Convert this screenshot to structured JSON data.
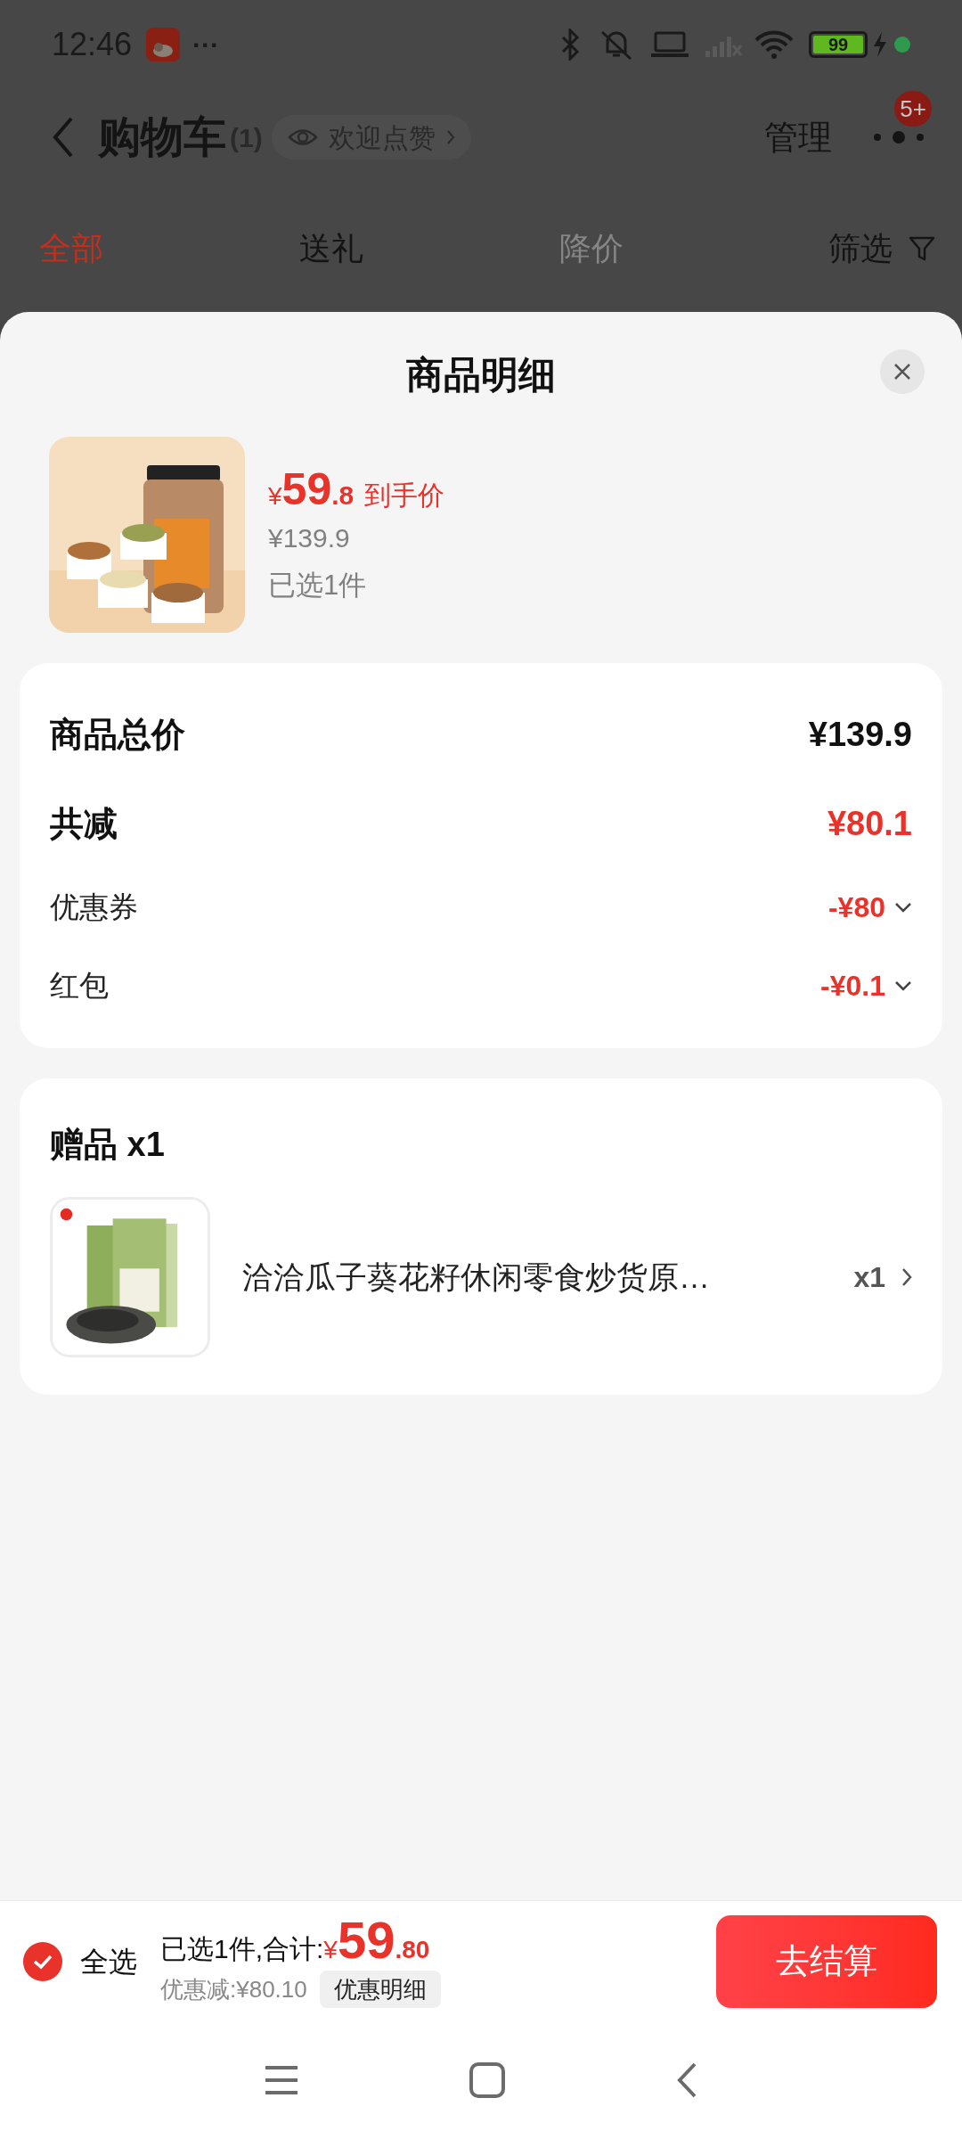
{
  "status_bar": {
    "time": "12:46",
    "more": "···",
    "battery": "99"
  },
  "header": {
    "title": "购物车",
    "count": "(1)",
    "like_chip": "欢迎点赞",
    "manage": "管理",
    "badge": "5+"
  },
  "tabs": [
    {
      "label": "全部",
      "selected": true,
      "disabled": false
    },
    {
      "label": "送礼",
      "selected": false,
      "disabled": false
    },
    {
      "label": "降价",
      "selected": false,
      "disabled": true
    }
  ],
  "filter": "筛选",
  "sheet": {
    "title": "商品明细",
    "product": {
      "currency": "¥",
      "price_int": "59",
      "price_dec": ".8",
      "price_label": "到手价",
      "original_price": "¥139.9",
      "selected_count": "已选1件"
    },
    "summary": [
      {
        "kind": "heading",
        "label": "商品总价",
        "value": "¥139.9",
        "highlight": false,
        "expandable": false
      },
      {
        "kind": "heading",
        "label": "共减",
        "value": "¥80.1",
        "highlight": true,
        "expandable": false
      },
      {
        "kind": "detail",
        "label": "优惠券",
        "value": "-¥80",
        "highlight": true,
        "expandable": true
      },
      {
        "kind": "detail",
        "label": "红包",
        "value": "-¥0.1",
        "highlight": true,
        "expandable": true
      }
    ],
    "gifts": {
      "title": "赠品 x1",
      "items": [
        {
          "name": "洽洽瓜子葵花籽休闲零食炒货原…",
          "quantity": "x1"
        }
      ]
    }
  },
  "bottom_bar": {
    "select_all": {
      "label": "全选",
      "checked": true
    },
    "summary": "已选1件,合计:",
    "currency": "¥",
    "price_int": "59",
    "price_dec": ".80",
    "discount": "优惠减:¥80.10",
    "details_button": "优惠明细",
    "checkout": "去结算"
  }
}
